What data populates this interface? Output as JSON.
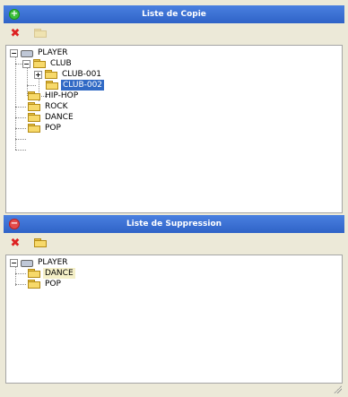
{
  "copy_panel": {
    "title": "Liste de Copie",
    "tree": {
      "root": "PLAYER",
      "club": "CLUB",
      "club001": "CLUB-001",
      "club002": "CLUB-002",
      "hiphop": "HIP-HOP",
      "rock": "ROCK",
      "dance": "DANCE",
      "pop": "POP"
    }
  },
  "delete_panel": {
    "title": "Liste de Suppression",
    "tree": {
      "root": "PLAYER",
      "dance": "DANCE",
      "pop": "POP"
    }
  },
  "glyphs": {
    "plus": "+",
    "minus": "−",
    "delete": "✖"
  },
  "colors": {
    "header_blue": "#3a6fd0",
    "selection": "#316ac5",
    "delete_red": "#d22"
  }
}
